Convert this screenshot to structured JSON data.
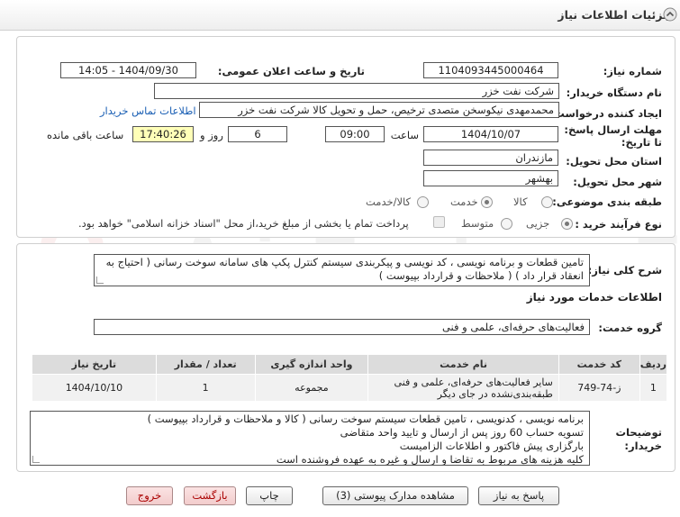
{
  "header": {
    "title": "جزئیات اطلاعات نیاز"
  },
  "form": {
    "need_number_label": "شماره نیاز:",
    "need_number": "1104093445000464",
    "announce_label": "تاریخ و ساعت اعلان عمومی:",
    "announce_value": "1404/09/30 - 14:05",
    "buyer_org_label": "نام دستگاه خریدار:",
    "buyer_org": "شرکت نفت خزر",
    "requester_label": "ایجاد کننده درخواست:",
    "requester": "محمدمهدی نیکوسخن متصدی ترخیص، حمل و تحویل کالا شرکت نفت خزر",
    "contact_link": "اطلاعات تماس خریدار",
    "deadline_label": "مهلت ارسال پاسخ: تا تاریخ:",
    "deadline_date": "1404/10/07",
    "time_label": "ساعت",
    "deadline_time": "09:00",
    "days_value": "6",
    "days_label": "روز و",
    "remaining_time": "17:40:26",
    "remaining_label": "ساعت باقی مانده",
    "province_label": "استان محل تحویل:",
    "province": "مازندران",
    "city_label": "شهر محل تحویل:",
    "city": "بهشهر",
    "category_label": "طبقه بندی موضوعی:",
    "category_options": [
      "کالا",
      "خدمت",
      "کالا/خدمت"
    ],
    "category_selected": "خدمت",
    "purchase_label": "نوع فرآیند خرید :",
    "purchase_options": [
      "جزیی",
      "متوسط"
    ],
    "purchase_selected": "جزیی",
    "purchase_note": "پرداخت تمام یا بخشی از مبلغ خرید،از محل \"اسناد خزانه اسلامی\" خواهد بود."
  },
  "general": {
    "desc_label": "شرح کلی نیاز:",
    "desc_text": "تامین قطعات و برنامه نویسی ، کد نویسی و پیکربندی سیستم کنترل پکپ های سامانه سوخت رسانی ( احتیاج به انعقاد قرار داد ) ( ملاحظات و قرارداد بپیوست )",
    "services_title": "اطلاعات خدمات مورد نیاز",
    "service_group_label": "گروه خدمت:",
    "service_group": "فعالیت‌های حرفه‌ای، علمی و فنی"
  },
  "table": {
    "headers": [
      "ردیف",
      "کد خدمت",
      "نام خدمت",
      "واحد اندازه گیری",
      "تعداد / مقدار",
      "تاریخ نیاز"
    ],
    "rows": [
      [
        "1",
        "ز-74-749",
        "سایر فعالیت‌های حرفه‌ای، علمی و فنی طبقه‌بندی‌نشده در جای دیگر",
        "مجموعه",
        "1",
        "1404/10/10"
      ]
    ]
  },
  "buyer_notes": {
    "label": "توضیحات خریدار:",
    "lines": [
      "برنامه نویسی ، کدنویسی ، تامین قطعات سیستم سوخت رسانی  ( کالا  و ملاحظات و قرارداد بپیوست )",
      "تسویه حساب 60 روز پس از ارسال و تایید واحد متقاضی",
      "بارگزاری پیش فاکتور و اطلاعات الزامیست",
      "کلیه هزینه های مربوط به تقاضا و ارسال و غیره به عهده فروشنده است"
    ]
  },
  "buttons": {
    "reply": "پاسخ به نیاز",
    "attachments": "مشاهده مدارک پیوستی (3)",
    "print": "چاپ",
    "back": "بازگشت",
    "exit": "خروج"
  },
  "watermark": "AriaTender.neT"
}
